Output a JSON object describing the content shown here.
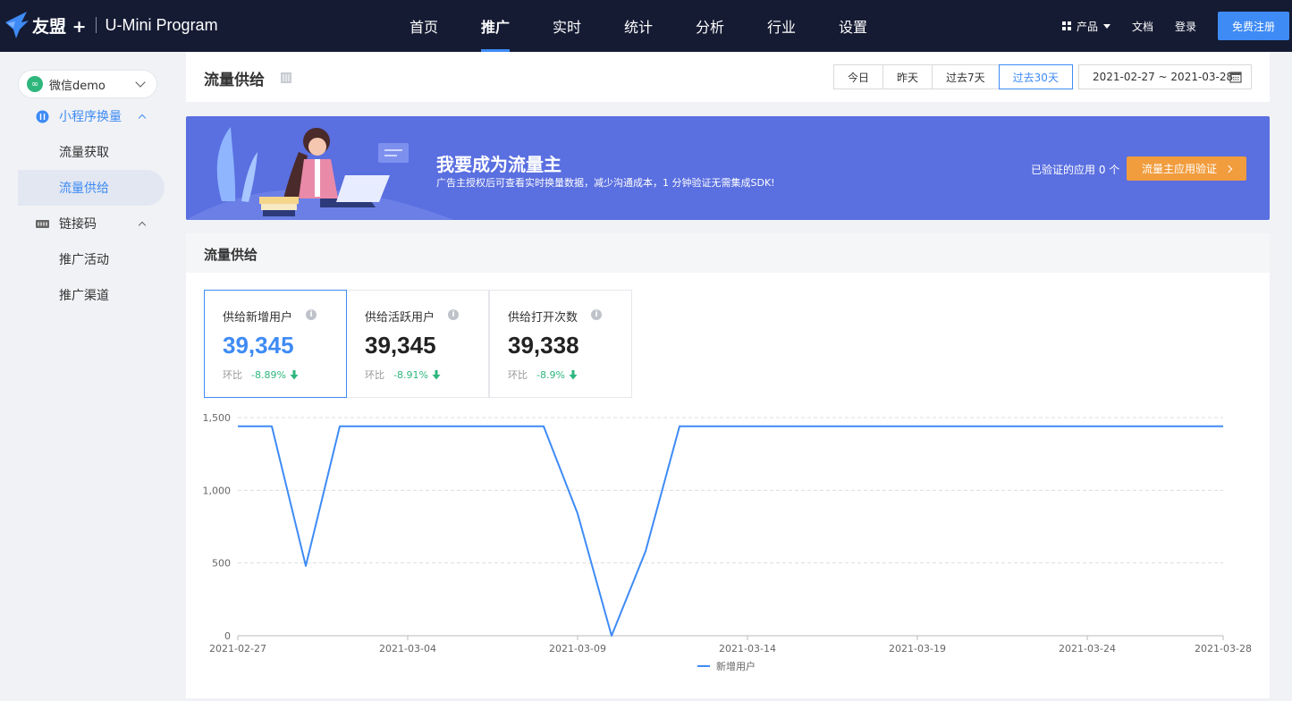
{
  "app": {
    "brand_name": "友盟 +",
    "product_name": "U-Mini Program"
  },
  "nav": {
    "items": [
      {
        "label": "首页",
        "active": false
      },
      {
        "label": "推广",
        "active": true
      },
      {
        "label": "实时",
        "active": false
      },
      {
        "label": "统计",
        "active": false
      },
      {
        "label": "分析",
        "active": false
      },
      {
        "label": "行业",
        "active": false
      },
      {
        "label": "设置",
        "active": false
      }
    ],
    "products_label": "产品",
    "docs_label": "文档",
    "login_label": "登录",
    "signup_label": "免费注册"
  },
  "sidebar": {
    "app_selector": "微信demo",
    "groups": [
      {
        "label": "小程序换量",
        "items": [
          "流量获取",
          "流量供给"
        ]
      },
      {
        "label": "链接码",
        "items": [
          "推广活动",
          "推广渠道"
        ]
      }
    ],
    "selected_item": "流量供给"
  },
  "header": {
    "title": "流量供给",
    "ranges": [
      "今日",
      "昨天",
      "过去7天",
      "过去30天"
    ],
    "active_range": "过去30天",
    "date_range": "2021-02-27 ~ 2021-03-28"
  },
  "banner": {
    "title": "我要成为流量主",
    "subtitle": "广告主授权后可查看实时换量数据，减少沟通成本，1 分钟验证无需集成SDK!",
    "verified_text": "已验证的应用 0 个",
    "button_label": "流量主应用验证"
  },
  "section": {
    "title": "流量供给"
  },
  "kpis": [
    {
      "label": "供给新增用户",
      "value": "39,345",
      "comp_label": "环比",
      "delta": "-8.89%",
      "active": true
    },
    {
      "label": "供给活跃用户",
      "value": "39,345",
      "comp_label": "环比",
      "delta": "-8.91%",
      "active": false
    },
    {
      "label": "供给打开次数",
      "value": "39,338",
      "comp_label": "环比",
      "delta": "-8.9%",
      "active": false
    }
  ],
  "colors": {
    "accent": "#3e8bf5",
    "nav_bg": "#151b33",
    "banner_bg": "#5a6fe0",
    "banner_button": "#f19c3d",
    "down_delta": "#2eb67d"
  },
  "chart_data": {
    "type": "line",
    "title": "",
    "xlabel": "",
    "ylabel": "",
    "ylim": [
      0,
      1500
    ],
    "y_ticks": [
      "0",
      "500",
      "1,000",
      "1,500"
    ],
    "x_tick_labels": [
      "2021-02-27",
      "2021-03-04",
      "2021-03-09",
      "2021-03-14",
      "2021-03-19",
      "2021-03-24",
      "2021-03-28"
    ],
    "grid": true,
    "legend_position": "bottom",
    "x": [
      "2021-02-27",
      "2021-02-28",
      "2021-03-01",
      "2021-03-02",
      "2021-03-03",
      "2021-03-04",
      "2021-03-05",
      "2021-03-06",
      "2021-03-07",
      "2021-03-08",
      "2021-03-09",
      "2021-03-10",
      "2021-03-11",
      "2021-03-12",
      "2021-03-13",
      "2021-03-14",
      "2021-03-15",
      "2021-03-16",
      "2021-03-17",
      "2021-03-18",
      "2021-03-19",
      "2021-03-20",
      "2021-03-21",
      "2021-03-22",
      "2021-03-23",
      "2021-03-24",
      "2021-03-25",
      "2021-03-26",
      "2021-03-27",
      "2021-03-28"
    ],
    "series": [
      {
        "name": "新增用户",
        "color": "#3e8bf5",
        "values": [
          1440,
          1440,
          480,
          1440,
          1440,
          1440,
          1440,
          1440,
          1440,
          1440,
          840,
          0,
          580,
          1440,
          1440,
          1440,
          1440,
          1440,
          1440,
          1440,
          1440,
          1440,
          1440,
          1440,
          1440,
          1440,
          1440,
          1440,
          1440,
          1440
        ]
      }
    ]
  }
}
